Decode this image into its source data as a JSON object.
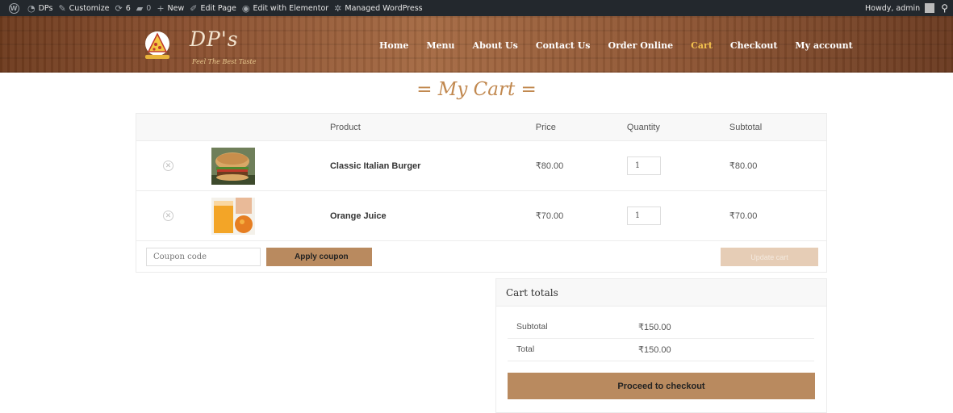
{
  "admin_bar": {
    "site_name": "DPs",
    "customize": "Customize",
    "updates_count": "6",
    "comments_count": "0",
    "new": "New",
    "edit_page": "Edit Page",
    "edit_elementor": "Edit with Elementor",
    "managed_wp": "Managed WordPress",
    "howdy": "Howdy, admin"
  },
  "header": {
    "logo_title": "DP's",
    "logo_tagline": "Feel The Best Taste",
    "nav": [
      {
        "label": "Home"
      },
      {
        "label": "Menu"
      },
      {
        "label": "About Us"
      },
      {
        "label": "Contact Us"
      },
      {
        "label": "Order Online"
      },
      {
        "label": "Cart"
      },
      {
        "label": "Checkout"
      },
      {
        "label": "My account"
      }
    ],
    "active_color": "#f2c14e"
  },
  "page_title": "= My Cart =",
  "cart": {
    "columns": {
      "product": "Product",
      "price": "Price",
      "quantity": "Quantity",
      "subtotal": "Subtotal"
    },
    "items": [
      {
        "name": "Classic Italian Burger",
        "price": "₹80.00",
        "quantity": "1",
        "subtotal": "₹80.00"
      },
      {
        "name": "Orange Juice",
        "price": "₹70.00",
        "quantity": "1",
        "subtotal": "₹70.00"
      }
    ],
    "coupon_placeholder": "Coupon code",
    "apply_coupon": "Apply coupon",
    "update_cart": "Update cart"
  },
  "totals": {
    "heading": "Cart totals",
    "subtotal_label": "Subtotal",
    "subtotal_value": "₹150.00",
    "total_label": "Total",
    "total_value": "₹150.00",
    "checkout_button": "Proceed to checkout"
  },
  "colors": {
    "accent": "#b98a5f",
    "title": "#c1884f",
    "admin_bar": "#23282d"
  }
}
